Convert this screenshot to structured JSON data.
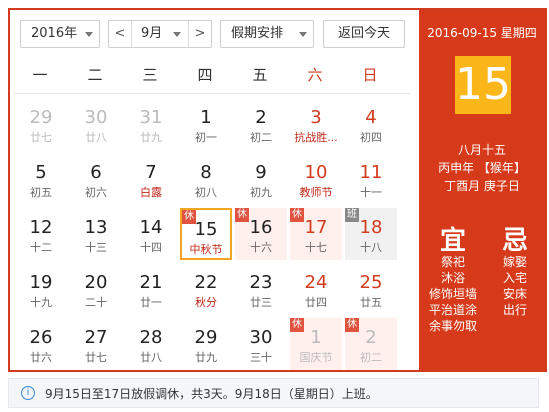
{
  "toolbar": {
    "year_value": "2016年",
    "month_value": "9月",
    "month_prev": "<",
    "month_next": ">",
    "holiday_value": "假期安排",
    "today_button": "返回今天"
  },
  "weekdays": [
    "一",
    "二",
    "三",
    "四",
    "五",
    "六",
    "日"
  ],
  "days": [
    {
      "n": "29",
      "s": "廿七",
      "dim": true
    },
    {
      "n": "30",
      "s": "廿八",
      "dim": true
    },
    {
      "n": "31",
      "s": "廿九",
      "dim": true
    },
    {
      "n": "1",
      "s": "初一"
    },
    {
      "n": "2",
      "s": "初二"
    },
    {
      "n": "3",
      "s": "抗战胜...",
      "wk": true,
      "fest": true
    },
    {
      "n": "4",
      "s": "初四",
      "wk": true
    },
    {
      "n": "5",
      "s": "初五"
    },
    {
      "n": "6",
      "s": "初六"
    },
    {
      "n": "7",
      "s": "白露",
      "fest": true
    },
    {
      "n": "8",
      "s": "初八"
    },
    {
      "n": "9",
      "s": "初九"
    },
    {
      "n": "10",
      "s": "教师节",
      "wk": true,
      "fest": true
    },
    {
      "n": "11",
      "s": "十一",
      "wk": true
    },
    {
      "n": "12",
      "s": "十二"
    },
    {
      "n": "13",
      "s": "十三"
    },
    {
      "n": "14",
      "s": "十四"
    },
    {
      "n": "15",
      "s": "中秋节",
      "fest": true,
      "tag": "休",
      "sel": true
    },
    {
      "n": "16",
      "s": "十六",
      "tag": "休",
      "rest": true
    },
    {
      "n": "17",
      "s": "十七",
      "wk": true,
      "tag": "休",
      "rest": true
    },
    {
      "n": "18",
      "s": "十八",
      "wk": true,
      "tag": "班",
      "workday": true
    },
    {
      "n": "19",
      "s": "十九"
    },
    {
      "n": "20",
      "s": "二十"
    },
    {
      "n": "21",
      "s": "廿一"
    },
    {
      "n": "22",
      "s": "秋分",
      "fest": true
    },
    {
      "n": "23",
      "s": "廿三"
    },
    {
      "n": "24",
      "s": "廿四",
      "wk": true
    },
    {
      "n": "25",
      "s": "廿五",
      "wk": true
    },
    {
      "n": "26",
      "s": "廿六"
    },
    {
      "n": "27",
      "s": "廿七"
    },
    {
      "n": "28",
      "s": "廿八"
    },
    {
      "n": "29",
      "s": "廿九"
    },
    {
      "n": "30",
      "s": "三十"
    },
    {
      "n": "1",
      "s": "国庆节",
      "dim": true,
      "tag": "休",
      "rest": true
    },
    {
      "n": "2",
      "s": "初二",
      "dim": true,
      "tag": "休",
      "rest": true
    }
  ],
  "detail": {
    "date_line": "2016-09-15 星期四",
    "big_day": "15",
    "lunar_date": "八月十五",
    "year_line": "丙申年 【猴年】",
    "month_day_line": "丁酉月 庚子日",
    "yi_label": "宜",
    "ji_label": "忌",
    "yi_items": [
      "祭祀",
      "沐浴",
      "修饰垣墙",
      "平治道涂",
      "余事勿取"
    ],
    "ji_items": [
      "嫁娶",
      "入宅",
      "安床",
      "出行"
    ]
  },
  "notice": {
    "icon": "i",
    "text": "9月15日至17日放假调休，共3天。9月18日（星期日）上班。"
  },
  "colors": {
    "accent": "#d63a1b",
    "today_bg": "#fbb61a",
    "rest_tag": "#e0533f",
    "work_tag": "#888888",
    "selected_border": "#f5a623"
  }
}
